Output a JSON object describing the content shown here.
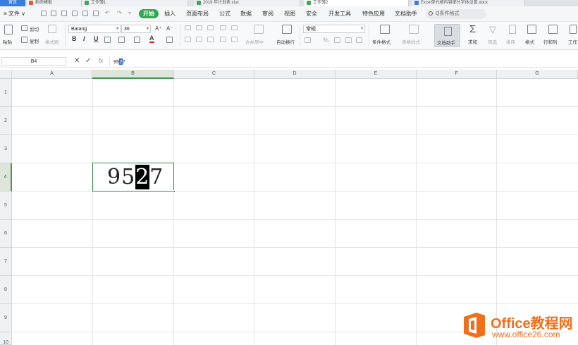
{
  "tabs": [
    {
      "label": "首页"
    },
    {
      "label": "稻壳模板"
    },
    {
      "label": "工作簿1"
    },
    {
      "label": "2019 年计划表.xlsx"
    },
    {
      "label": "工作簿2"
    },
    {
      "label": "Excel单元格内容部分字体设置.docx"
    }
  ],
  "menubar": {
    "file_menu": "≡ 文件 ∨",
    "start": "开始",
    "items": [
      "插入",
      "页面布局",
      "公式",
      "数据",
      "审阅",
      "视图",
      "安全",
      "开发工具",
      "特色应用",
      "文档助手"
    ],
    "search_placeholder": "Q条件格式"
  },
  "ribbon": {
    "paste": "粘贴",
    "cut": "剪切",
    "copy": "复制",
    "format_painter": "格式刷",
    "font_name": "Batang",
    "font_size": "36",
    "bold": "B",
    "italic": "I",
    "underline": "U",
    "grow_font": "A⁺",
    "shrink_font": "A⁻",
    "merge_center": "合并居中",
    "wrap_text": "自动换行",
    "number_format": "常规",
    "percent": "%",
    "conditional_format": "条件格式",
    "table_style": "表格样式",
    "doc_assistant": "文档助手",
    "sum": "求和",
    "filter": "筛选",
    "sort": "排序",
    "format": "格式",
    "row_col": "行和列",
    "worksheet": "工作"
  },
  "formula_bar": {
    "cell_ref": "B4",
    "cancel": "✕",
    "confirm": "✓",
    "fx": "fx",
    "content_before": "95",
    "content_selected": "2",
    "content_after": "7"
  },
  "grid": {
    "columns": [
      "A",
      "B",
      "C",
      "D",
      "E",
      "F",
      "G"
    ],
    "rows": [
      "1",
      "2",
      "3",
      "4",
      "5",
      "6",
      "7",
      "8",
      "9",
      "10"
    ],
    "selected_column": "B",
    "selected_row": "4",
    "cell_value_before": "95",
    "cell_value_selected": "2",
    "cell_value_after": "7"
  },
  "watermark": {
    "brand": "Office教程网",
    "url": "www.office26.com",
    "color": "#f06f1a"
  },
  "colors": {
    "start_button": "#2fa84f",
    "selection_green": "#2f8d4a",
    "formula_highlight": "#2b6fd0"
  }
}
